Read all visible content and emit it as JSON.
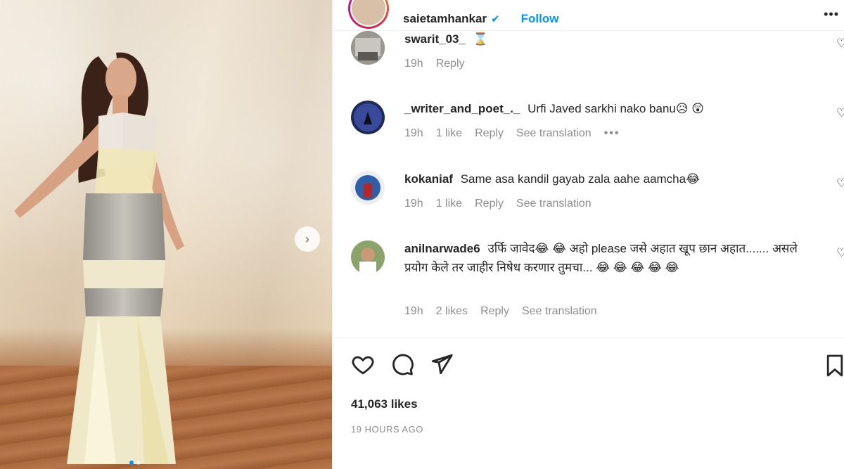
{
  "post": {
    "username": "saietamhankar",
    "verified_icon": "verified-badge-icon",
    "follow_label": "Follow",
    "carousel_index": 1,
    "carousel_total": 2
  },
  "comments": [
    {
      "username": "swarit_03_",
      "text": "⌛",
      "time": "19h",
      "likes": "",
      "reply": "Reply",
      "translate": ""
    },
    {
      "username": "_writer_and_poet_._",
      "text": "Urfi Javed sarkhi nako banu😥 😲",
      "time": "19h",
      "likes": "1 like",
      "reply": "Reply",
      "translate": "See translation",
      "more": "•••"
    },
    {
      "username": "kokaniaf",
      "text": "Same asa kandil gayab zala aahe aamcha😂",
      "time": "19h",
      "likes": "1 like",
      "reply": "Reply",
      "translate": "See translation"
    },
    {
      "username": "anilnarwade6",
      "text": "उर्फि जावेद😂 😂  अहो please जसे अहात खूप छान अहात....... असले प्रयोग केले तर जाहीर निषेध करणार तुमचा... 😂 😂 😂 😂 😂",
      "time": "19h",
      "likes": "2 likes",
      "reply": "Reply",
      "translate": "See translation"
    }
  ],
  "actions": {
    "like_icon": "heart-icon",
    "comment_icon": "comment-icon",
    "share_icon": "paper-plane-icon",
    "save_icon": "bookmark-icon"
  },
  "likes_count": "41,063 likes",
  "posted_ago": "19 HOURS AGO",
  "colors": {
    "accent": "#0095f6",
    "text": "#262626",
    "muted": "#8e8e8e",
    "divider": "#efefef"
  }
}
